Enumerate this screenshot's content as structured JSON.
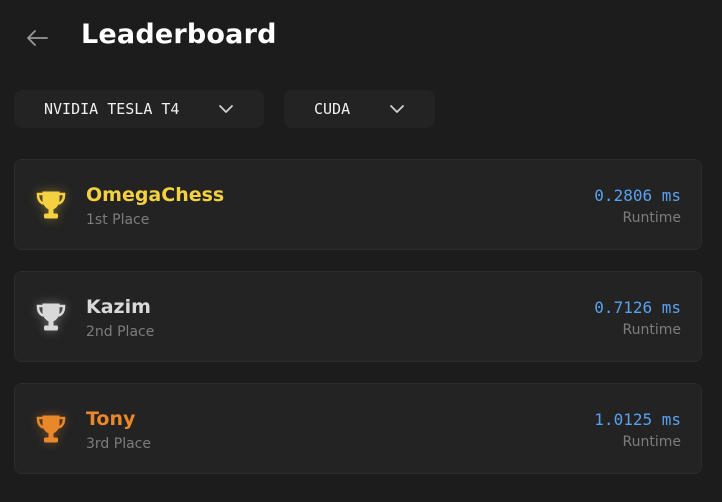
{
  "header": {
    "title": "Leaderboard"
  },
  "filters": {
    "gpu": "NVIDIA TESLA T4",
    "language": "CUDA"
  },
  "entries": [
    {
      "name": "OmegaChess",
      "place": "1st Place",
      "time": "0.2806 ms",
      "time_label": "Runtime",
      "color": "#f5d040",
      "trophy": "trophy-gold-icon"
    },
    {
      "name": "Kazim",
      "place": "2nd Place",
      "time": "0.7126 ms",
      "time_label": "Runtime",
      "color": "#d9d9d9",
      "trophy": "trophy-silver-icon"
    },
    {
      "name": "Tony",
      "place": "3rd Place",
      "time": "1.0125 ms",
      "time_label": "Runtime",
      "color": "#e8882a",
      "trophy": "trophy-bronze-icon"
    }
  ],
  "colors": {
    "background": "#1c1c1c",
    "card": "#232323",
    "runtime": "#5aa0ee",
    "muted": "#7d7d7d"
  }
}
